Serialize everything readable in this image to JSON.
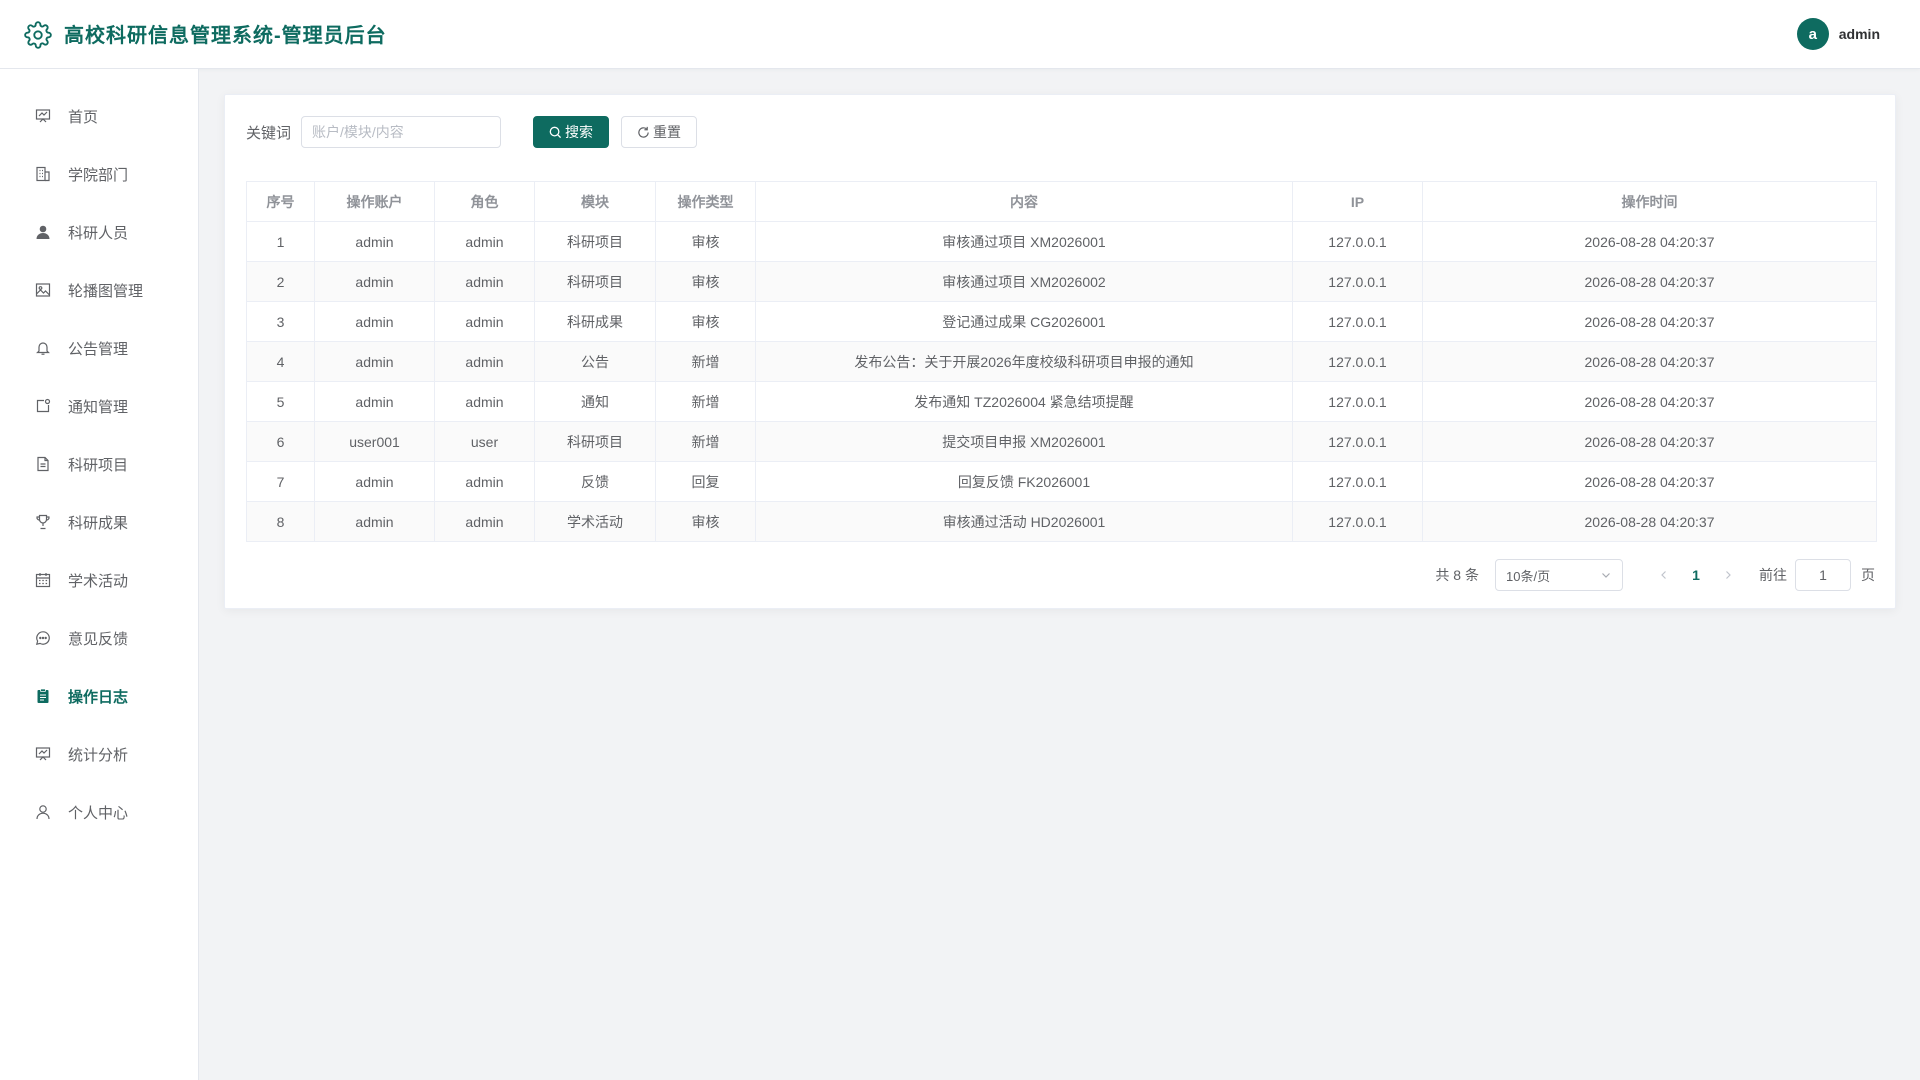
{
  "header": {
    "title": "高校科研信息管理系统-管理员后台",
    "avatar_letter": "a",
    "username": "admin",
    "accent_color": "#0e6b60"
  },
  "sidebar": {
    "items": [
      {
        "label": "首页",
        "icon": "dashboard-icon"
      },
      {
        "label": "学院部门",
        "icon": "building-icon"
      },
      {
        "label": "科研人员",
        "icon": "user-filled-icon"
      },
      {
        "label": "轮播图管理",
        "icon": "picture-icon"
      },
      {
        "label": "公告管理",
        "icon": "bell-icon"
      },
      {
        "label": "通知管理",
        "icon": "message-box-icon"
      },
      {
        "label": "科研项目",
        "icon": "document-icon"
      },
      {
        "label": "科研成果",
        "icon": "trophy-icon"
      },
      {
        "label": "学术活动",
        "icon": "calendar-icon"
      },
      {
        "label": "意见反馈",
        "icon": "chat-icon"
      },
      {
        "label": "操作日志",
        "icon": "clipboard-icon",
        "active": true
      },
      {
        "label": "统计分析",
        "icon": "presentation-icon"
      },
      {
        "label": "个人中心",
        "icon": "user-icon"
      }
    ]
  },
  "search": {
    "label": "关键词",
    "placeholder": "账户/模块/内容",
    "value": "",
    "search_button": "搜索",
    "reset_button": "重置"
  },
  "table": {
    "columns": [
      "序号",
      "操作账户",
      "角色",
      "模块",
      "操作类型",
      "内容",
      "IP",
      "操作时间"
    ],
    "rows": [
      [
        "1",
        "admin",
        "admin",
        "科研项目",
        "审核",
        "审核通过项目 XM2026001",
        "127.0.0.1",
        "2026-08-28 04:20:37"
      ],
      [
        "2",
        "admin",
        "admin",
        "科研项目",
        "审核",
        "审核通过项目 XM2026002",
        "127.0.0.1",
        "2026-08-28 04:20:37"
      ],
      [
        "3",
        "admin",
        "admin",
        "科研成果",
        "审核",
        "登记通过成果 CG2026001",
        "127.0.0.1",
        "2026-08-28 04:20:37"
      ],
      [
        "4",
        "admin",
        "admin",
        "公告",
        "新增",
        "发布公告：关于开展2026年度校级科研项目申报的通知",
        "127.0.0.1",
        "2026-08-28 04:20:37"
      ],
      [
        "5",
        "admin",
        "admin",
        "通知",
        "新增",
        "发布通知 TZ2026004 紧急结项提醒",
        "127.0.0.1",
        "2026-08-28 04:20:37"
      ],
      [
        "6",
        "user001",
        "user",
        "科研项目",
        "新增",
        "提交项目申报 XM2026001",
        "127.0.0.1",
        "2026-08-28 04:20:37"
      ],
      [
        "7",
        "admin",
        "admin",
        "反馈",
        "回复",
        "回复反馈 FK2026001",
        "127.0.0.1",
        "2026-08-28 04:20:37"
      ],
      [
        "8",
        "admin",
        "admin",
        "学术活动",
        "审核",
        "审核通过活动 HD2026001",
        "127.0.0.1",
        "2026-08-28 04:20:37"
      ]
    ]
  },
  "pagination": {
    "total_text": "共 8 条",
    "page_size": "10条/页",
    "current_page": "1",
    "goto_label": "前往",
    "goto_value": "1",
    "page_unit": "页"
  }
}
